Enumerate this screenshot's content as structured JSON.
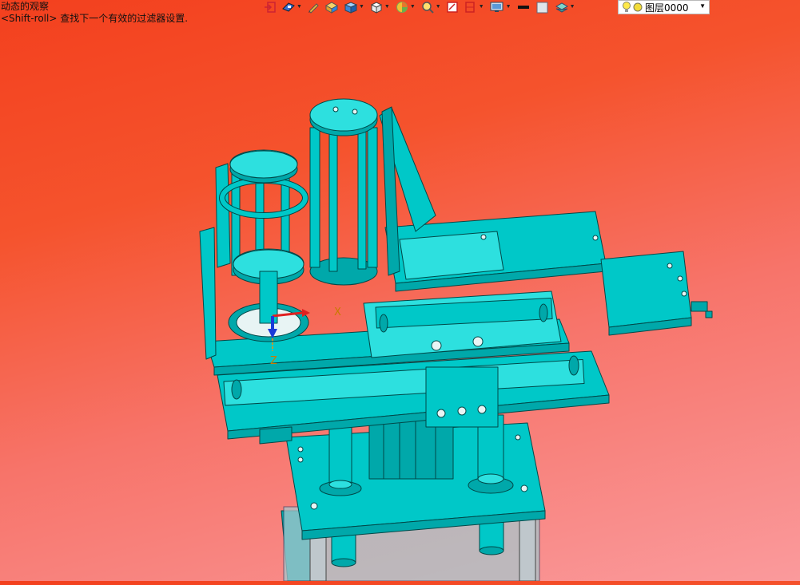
{
  "status": {
    "line1": "动态的观察",
    "line2": "<Shift-roll> 查找下一个有效的过滤器设置."
  },
  "toolbar": {
    "icons": [
      "exit-sketch-icon",
      "select-filter-icon",
      "pen-icon",
      "box-icon",
      "cube-icon",
      "view-cube-icon",
      "render-mode-icon",
      "zoom-icon",
      "section-icon",
      "ruler-icon",
      "display-icon",
      "line-color-icon",
      "fill-color-icon",
      "layer-stack-icon"
    ]
  },
  "layer": {
    "name": "图层0000"
  },
  "axes": {
    "x": "X",
    "z": "Z"
  },
  "colors": {
    "model": "#00cccc",
    "accent_dark": "#006a6a",
    "bg_top": "#f3401e",
    "bg_bottom": "#fa9a9c"
  }
}
